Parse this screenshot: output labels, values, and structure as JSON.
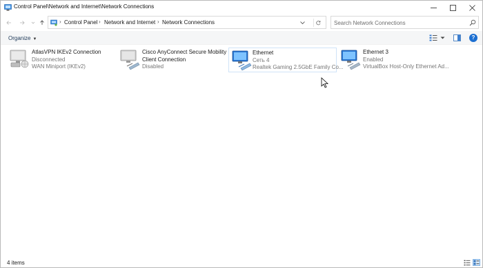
{
  "window": {
    "title": "Control Panel\\Network and Internet\\Network Connections"
  },
  "address": {
    "crumbs": [
      "Control Panel",
      "Network and Internet",
      "Network Connections"
    ]
  },
  "search": {
    "placeholder": "Search Network Connections"
  },
  "toolbar": {
    "organize_label": "Organize",
    "organize_caret": "▼"
  },
  "connections": [
    {
      "name": "AtlasVPN IKEv2 Connection",
      "line2": "Disconnected",
      "line3": "WAN Miniport (IKEv2)",
      "icon": "vpn-connection-icon"
    },
    {
      "name": "Cisco AnyConnect Secure Mobility",
      "line2": "Client Connection",
      "line3": "Disabled",
      "icon": "network-adapter-disabled-icon"
    },
    {
      "name": "Ethernet",
      "line2": "Сеть 4",
      "line3": "Realtek Gaming 2.5GbE Family Co...",
      "icon": "ethernet-adapter-icon"
    },
    {
      "name": "Ethernet 3",
      "line2": "Enabled",
      "line3": "VirtualBox Host-Only Ethernet Ad...",
      "icon": "ethernet-adapter-icon"
    }
  ],
  "status": {
    "item_count": "4 items"
  },
  "help_glyph": "?",
  "colors": {
    "accent": "#1c6fd1",
    "selection_border": "#cfe3f7",
    "secondary_text": "#767676"
  }
}
